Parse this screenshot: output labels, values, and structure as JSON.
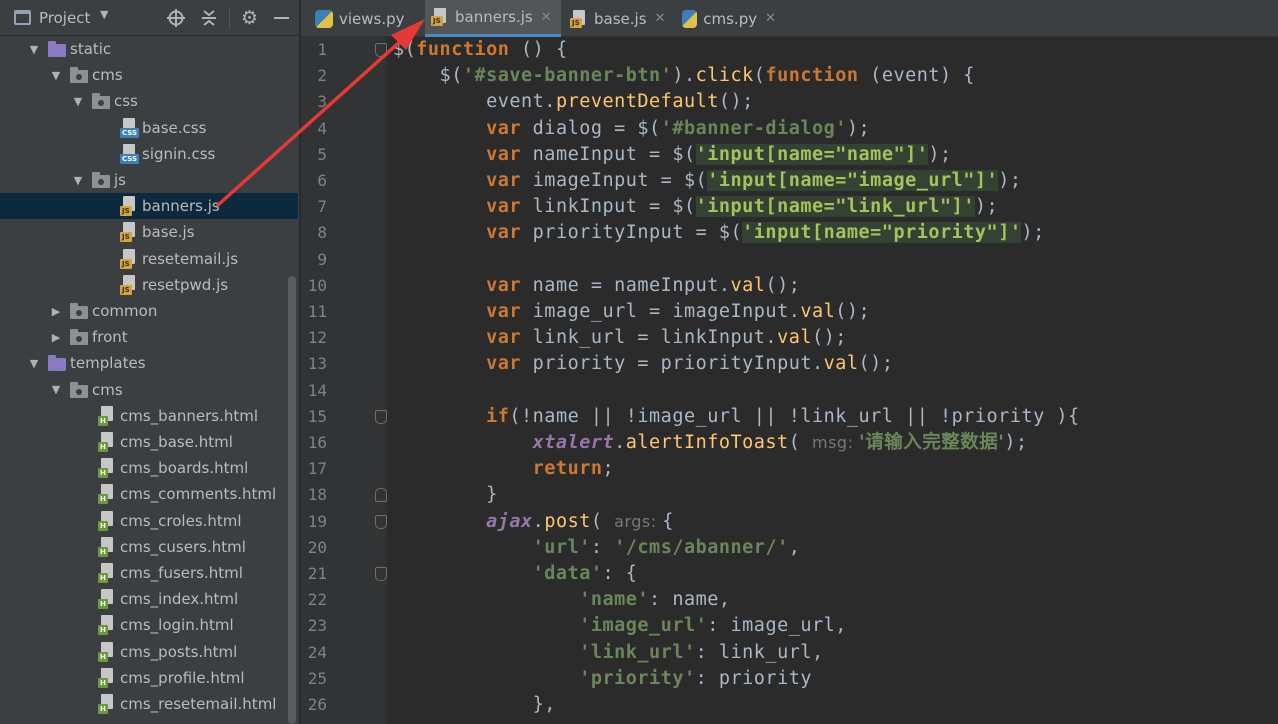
{
  "project_panel": {
    "title": "Project",
    "tree": [
      {
        "label": "static",
        "kind": "folder-purple",
        "expanded": true
      },
      {
        "label": "cms",
        "kind": "folder-gray",
        "expanded": true
      },
      {
        "label": "css",
        "kind": "folder-gray",
        "expanded": true
      },
      {
        "label": "base.css",
        "kind": "css"
      },
      {
        "label": "signin.css",
        "kind": "css"
      },
      {
        "label": "js",
        "kind": "folder-gray",
        "expanded": true
      },
      {
        "label": "banners.js",
        "kind": "js",
        "selected": true
      },
      {
        "label": "base.js",
        "kind": "js"
      },
      {
        "label": "resetemail.js",
        "kind": "js"
      },
      {
        "label": "resetpwd.js",
        "kind": "js"
      },
      {
        "label": "common",
        "kind": "folder-gray",
        "expanded": false
      },
      {
        "label": "front",
        "kind": "folder-gray",
        "expanded": false
      },
      {
        "label": "templates",
        "kind": "folder-purple",
        "expanded": true
      },
      {
        "label": "cms",
        "kind": "folder-gray",
        "expanded": true
      },
      {
        "label": "cms_banners.html",
        "kind": "html"
      },
      {
        "label": "cms_base.html",
        "kind": "html"
      },
      {
        "label": "cms_boards.html",
        "kind": "html"
      },
      {
        "label": "cms_comments.html",
        "kind": "html"
      },
      {
        "label": "cms_croles.html",
        "kind": "html"
      },
      {
        "label": "cms_cusers.html",
        "kind": "html"
      },
      {
        "label": "cms_fusers.html",
        "kind": "html"
      },
      {
        "label": "cms_index.html",
        "kind": "html"
      },
      {
        "label": "cms_login.html",
        "kind": "html"
      },
      {
        "label": "cms_posts.html",
        "kind": "html"
      },
      {
        "label": "cms_profile.html",
        "kind": "html"
      },
      {
        "label": "cms_resetemail.html",
        "kind": "html"
      }
    ]
  },
  "tabs": [
    {
      "label": "views.py",
      "icon": "python-file-icon",
      "active": false
    },
    {
      "label": "banners.js",
      "icon": "js-file-icon",
      "active": true
    },
    {
      "label": "base.js",
      "icon": "js-file-icon",
      "active": false
    },
    {
      "label": "cms.py",
      "icon": "python-file-icon",
      "active": false
    }
  ],
  "editor": {
    "line_numbers": [
      "1",
      "2",
      "3",
      "4",
      "5",
      "6",
      "7",
      "8",
      "9",
      "10",
      "11",
      "12",
      "13",
      "14",
      "15",
      "16",
      "17",
      "18",
      "19",
      "20",
      "21",
      "22",
      "23",
      "24",
      "25",
      "26"
    ],
    "lines": [
      [
        [
          "p",
          "$("
        ],
        [
          "kw",
          "function"
        ],
        [
          "p",
          " () {"
        ]
      ],
      [
        [
          "p",
          "    $("
        ],
        [
          "str",
          "'#save-banner-btn'"
        ],
        [
          "p",
          ")."
        ],
        [
          "fn",
          "click"
        ],
        [
          "p",
          "("
        ],
        [
          "kw",
          "function"
        ],
        [
          "p",
          " (event) {"
        ]
      ],
      [
        [
          "p",
          "        event."
        ],
        [
          "fn",
          "preventDefault"
        ],
        [
          "p",
          "();"
        ]
      ],
      [
        [
          "p",
          "        "
        ],
        [
          "kw",
          "var"
        ],
        [
          "p",
          " dialog = $("
        ],
        [
          "str",
          "'#banner-dialog'"
        ],
        [
          "p",
          ");"
        ]
      ],
      [
        [
          "p",
          "        "
        ],
        [
          "kw",
          "var"
        ],
        [
          "p",
          " nameInput = $("
        ],
        [
          "strhi",
          "'input[name=\"name\"]'"
        ],
        [
          "p",
          ");"
        ]
      ],
      [
        [
          "p",
          "        "
        ],
        [
          "kw",
          "var"
        ],
        [
          "p",
          " imageInput = $("
        ],
        [
          "strhi",
          "'input[name=\"image_url\"]'"
        ],
        [
          "p",
          ");"
        ]
      ],
      [
        [
          "p",
          "        "
        ],
        [
          "kw",
          "var"
        ],
        [
          "p",
          " linkInput = $("
        ],
        [
          "strhi",
          "'input[name=\"link_url\"]'"
        ],
        [
          "p",
          ");"
        ]
      ],
      [
        [
          "p",
          "        "
        ],
        [
          "kw",
          "var"
        ],
        [
          "p",
          " priorityInput = $("
        ],
        [
          "strhi",
          "'input[name=\"priority\"]'"
        ],
        [
          "p",
          ");"
        ]
      ],
      [
        [
          "p",
          ""
        ]
      ],
      [
        [
          "p",
          "        "
        ],
        [
          "kw",
          "var"
        ],
        [
          "p",
          " name = nameInput."
        ],
        [
          "fn",
          "val"
        ],
        [
          "p",
          "();"
        ]
      ],
      [
        [
          "p",
          "        "
        ],
        [
          "kw",
          "var"
        ],
        [
          "p",
          " image_url = imageInput."
        ],
        [
          "fn",
          "val"
        ],
        [
          "p",
          "();"
        ]
      ],
      [
        [
          "p",
          "        "
        ],
        [
          "kw",
          "var"
        ],
        [
          "p",
          " link_url = linkInput."
        ],
        [
          "fn",
          "val"
        ],
        [
          "p",
          "();"
        ]
      ],
      [
        [
          "p",
          "        "
        ],
        [
          "kw",
          "var"
        ],
        [
          "p",
          " priority = priorityInput."
        ],
        [
          "fn",
          "val"
        ],
        [
          "p",
          "();"
        ]
      ],
      [
        [
          "p",
          ""
        ]
      ],
      [
        [
          "p",
          "        "
        ],
        [
          "kw",
          "if"
        ],
        [
          "p",
          "(!name || !image_url || !link_url || !priority ){"
        ]
      ],
      [
        [
          "p",
          "            "
        ],
        [
          "glob",
          "xtalert"
        ],
        [
          "p",
          "."
        ],
        [
          "fn",
          "alertInfoToast"
        ],
        [
          "p",
          "( "
        ],
        [
          "hint",
          "msg: "
        ],
        [
          "cjk",
          "'请输入完整数据'"
        ],
        [
          "p",
          ");"
        ]
      ],
      [
        [
          "p",
          "            "
        ],
        [
          "kw",
          "return"
        ],
        [
          "p",
          ";"
        ]
      ],
      [
        [
          "p",
          "        }"
        ]
      ],
      [
        [
          "p",
          "        "
        ],
        [
          "glob",
          "ajax"
        ],
        [
          "p",
          "."
        ],
        [
          "fn",
          "post"
        ],
        [
          "p",
          "( "
        ],
        [
          "hint",
          "args: "
        ],
        [
          "p",
          "{"
        ]
      ],
      [
        [
          "p",
          "            "
        ],
        [
          "str",
          "'url'"
        ],
        [
          "p",
          ": "
        ],
        [
          "str",
          "'/cms/abanner/'"
        ],
        [
          "p",
          ","
        ]
      ],
      [
        [
          "p",
          "            "
        ],
        [
          "str",
          "'data'"
        ],
        [
          "p",
          ": {"
        ]
      ],
      [
        [
          "p",
          "                "
        ],
        [
          "str",
          "'name'"
        ],
        [
          "p",
          ": name,"
        ]
      ],
      [
        [
          "p",
          "                "
        ],
        [
          "str",
          "'image_url'"
        ],
        [
          "p",
          ": image_url,"
        ]
      ],
      [
        [
          "p",
          "                "
        ],
        [
          "str",
          "'link_url'"
        ],
        [
          "p",
          ": link_url,"
        ]
      ],
      [
        [
          "p",
          "                "
        ],
        [
          "str",
          "'priority'"
        ],
        [
          "p",
          ": priority"
        ]
      ],
      [
        [
          "p",
          "            },"
        ]
      ]
    ]
  },
  "colors": {
    "annotation_arrow": "#e53935",
    "selection": "#0d293e",
    "editor_bg": "#2b2b2b"
  }
}
